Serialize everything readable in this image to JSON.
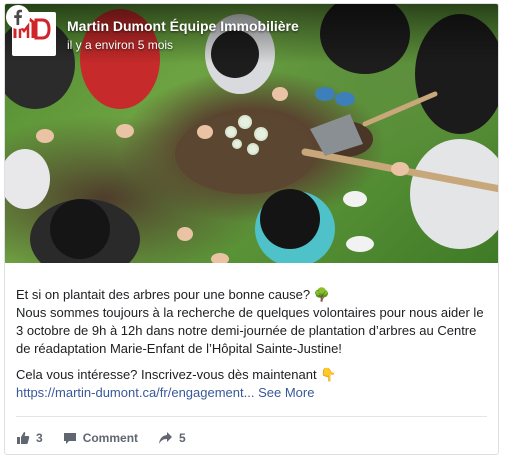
{
  "header": {
    "page_name": "Martin Dumont Équipe Immobilière",
    "time": "il y a environ 5 mois",
    "logo_text": "MD",
    "brand_color": "#d1232a"
  },
  "post": {
    "line1": "Et si on plantait des arbres pour une bonne cause? 🌳",
    "line2": "Nous sommes toujours à la recherche de quelques volontaires pour nous aider le 3 octobre de 9h à 12h dans notre demi-journée de plantation d’arbres au Centre de réadaptation Marie-Enfant de l’Hôpital Sainte-Justine!",
    "line3": "Cela vous intéresse? Inscrivez-vous dès maintenant 👇",
    "link": "https://martin-dumont.ca/fr/engagement...",
    "see_more": "See More"
  },
  "actions": {
    "likes": "3",
    "comment_label": "Comment",
    "shares": "5"
  },
  "icons": {
    "facebook": "facebook-icon",
    "like": "thumbs-up-icon",
    "comment": "comment-icon",
    "share": "share-icon"
  }
}
